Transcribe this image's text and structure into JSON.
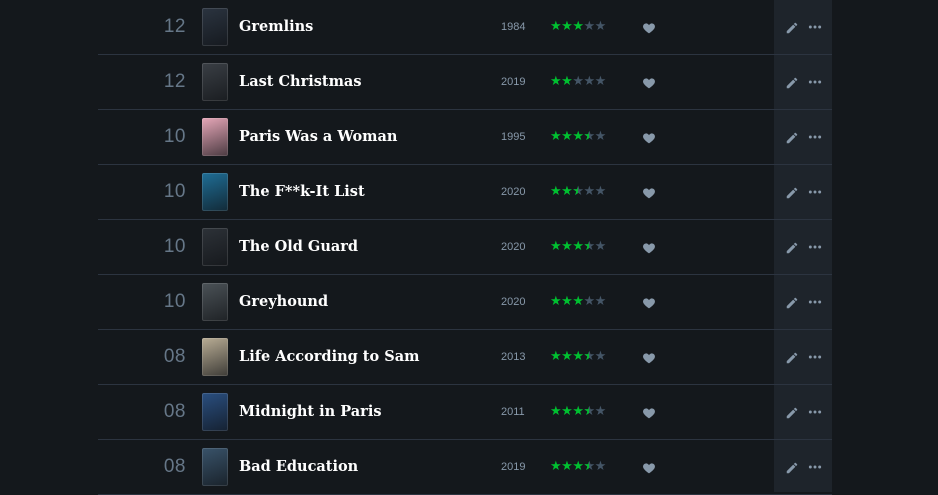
{
  "colors": {
    "background": "#14181c",
    "accent_green": "#00c030",
    "divider": "#2c3440",
    "muted": "#667788"
  },
  "icons": {
    "like": "heart-icon",
    "edit": "pencil-icon",
    "more": "ellipsis-icon"
  },
  "entries": [
    {
      "day": "12",
      "title": "Gremlins",
      "year": "1984",
      "rating": 3.0,
      "liked": true,
      "poster": "#2b3440"
    },
    {
      "day": "12",
      "title": "Last Christmas",
      "year": "2019",
      "rating": 2.0,
      "liked": true,
      "poster": "#3a3f45"
    },
    {
      "day": "10",
      "title": "Paris Was a Woman",
      "year": "1995",
      "rating": 3.5,
      "liked": true,
      "poster": "#e6a7b8"
    },
    {
      "day": "10",
      "title": "The F**k-It List",
      "year": "2020",
      "rating": 2.5,
      "liked": true,
      "poster": "#1f6e96"
    },
    {
      "day": "10",
      "title": "The Old Guard",
      "year": "2020",
      "rating": 3.5,
      "liked": true,
      "poster": "#2d3238"
    },
    {
      "day": "10",
      "title": "Greyhound",
      "year": "2020",
      "rating": 3.0,
      "liked": true,
      "poster": "#4b5257"
    },
    {
      "day": "08",
      "title": "Life According to Sam",
      "year": "2013",
      "rating": 3.5,
      "liked": true,
      "poster": "#b9ad95"
    },
    {
      "day": "08",
      "title": "Midnight in Paris",
      "year": "2011",
      "rating": 3.5,
      "liked": true,
      "poster": "#2a4f80"
    },
    {
      "day": "08",
      "title": "Bad Education",
      "year": "2019",
      "rating": 3.5,
      "liked": true,
      "poster": "#39536a"
    }
  ]
}
